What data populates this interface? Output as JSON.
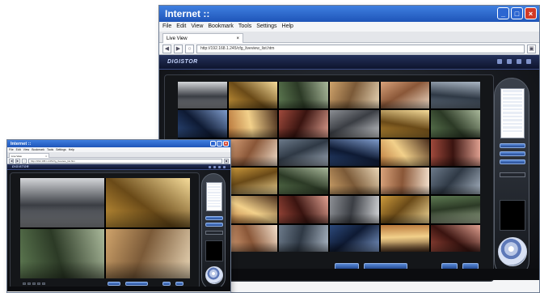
{
  "browser": {
    "title": "Internet ::",
    "menu": [
      "File",
      "Edit",
      "View",
      "Bookmark",
      "Tools",
      "Settings",
      "Help"
    ],
    "tab": "Live View",
    "url": "http://192.168.1.245/cfg_liveview_list.htm",
    "controls": {
      "min": "_",
      "max": "□",
      "close": "×"
    },
    "nav": {
      "back": "◀",
      "forward": "▶",
      "reload": "○"
    }
  },
  "app": {
    "logo": "DIGISTOR",
    "toolbar_icons": [
      "camera-icon",
      "settings-icon",
      "user-icon",
      "power-icon"
    ],
    "large_grid_tiles": 36,
    "small_grid_tiles": 4
  },
  "colors": {
    "title_bar": "#2c66d1",
    "close_button": "#d23a26",
    "app_background": "#0b0c0f",
    "accent_button": "#3f6fc4"
  }
}
